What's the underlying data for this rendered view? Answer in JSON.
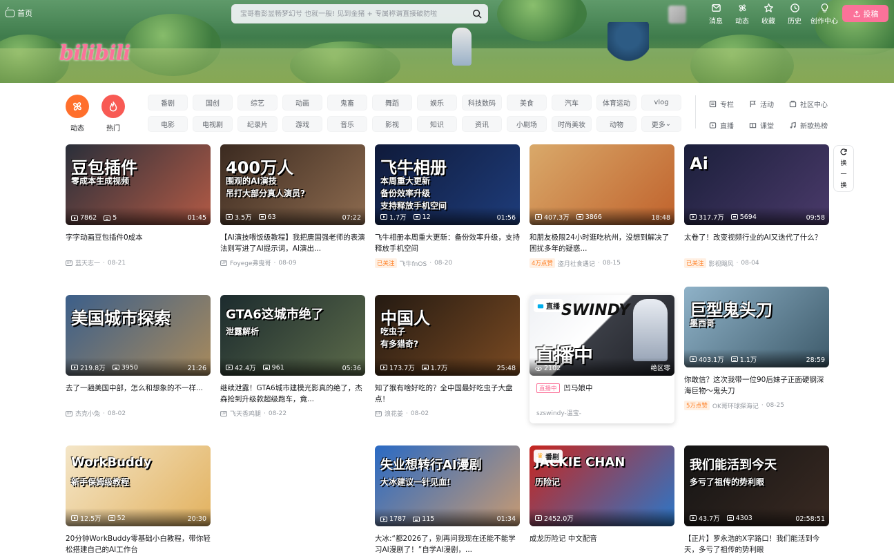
{
  "header": {
    "home_label": "首页",
    "search_placeholder": "宝哥看彭昱畅梦幻号 也就一般! 见到金猪 + 专属称谓直接破防啦",
    "logo_text": "bilibili",
    "nav": [
      {
        "label": "消息",
        "icon": "mail-icon"
      },
      {
        "label": "动态",
        "icon": "fan-icon"
      },
      {
        "label": "收藏",
        "icon": "star-icon"
      },
      {
        "label": "历史",
        "icon": "clock-icon"
      },
      {
        "label": "创作中心",
        "icon": "bulb-icon"
      }
    ],
    "upload_label": "投稿"
  },
  "channels": {
    "dynamic_label": "动态",
    "hot_label": "热门",
    "row1": [
      "番剧",
      "国创",
      "综艺",
      "动画",
      "鬼畜",
      "舞蹈",
      "娱乐",
      "科技数码",
      "美食",
      "汽车",
      "体育运动",
      "vlog"
    ],
    "row2": [
      "电影",
      "电视剧",
      "纪录片",
      "游戏",
      "音乐",
      "影视",
      "知识",
      "资讯",
      "小剧场",
      "时尚美妆",
      "动物",
      "更多"
    ],
    "side": [
      {
        "label": "专栏",
        "icon": "column-icon"
      },
      {
        "label": "活动",
        "icon": "flag-icon"
      },
      {
        "label": "社区中心",
        "icon": "community-icon"
      },
      {
        "label": "直播",
        "icon": "live-icon"
      },
      {
        "label": "课堂",
        "icon": "class-icon"
      },
      {
        "label": "新歌热榜",
        "icon": "music-icon"
      }
    ]
  },
  "refresh_label": [
    "换",
    "一",
    "换"
  ],
  "cards": [
    {
      "thumb_text": [
        "豆包插件",
        "零成本生成视频"
      ],
      "colors": [
        "#2a2f3a",
        "#b35a45"
      ],
      "views": "7862",
      "danmaku": "5",
      "duration": "01:45",
      "title": "字字动画豆包插件0成本",
      "follow": "",
      "author": "蓝天志一",
      "date": "08-21"
    },
    {
      "thumb_text": [
        "400万人",
        "围观的AI演技",
        "吊打大部分真人演员?"
      ],
      "colors": [
        "#3b2a20",
        "#8d6b4f"
      ],
      "views": "3.5万",
      "danmaku": "63",
      "duration": "07:22",
      "title": "【AI演技喂饭级教程】我把唐国强老师的表演法则写进了AI提示词，AI演出...",
      "follow": "",
      "author": "Foyege弗曳哥",
      "date": "08-09"
    },
    {
      "thumb_text": [
        "飞牛相册",
        "本周重大更新",
        "备份效率升级",
        "支持释放手机空间"
      ],
      "colors": [
        "#0f1a3a",
        "#1e3c7a"
      ],
      "views": "1.7万",
      "danmaku": "12",
      "duration": "01:56",
      "title": "飞牛相册本周重大更新：备份效率升级，支持释放手机空间",
      "follow": "已关注",
      "author": "飞牛fnOS",
      "date": "08-20"
    },
    {
      "thumb_text": [],
      "colors": [
        "#d9a96a",
        "#c0622c"
      ],
      "views": "407.3万",
      "danmaku": "3866",
      "duration": "18:48",
      "title": "和朋友极限24小时逛吃杭州，没想到解决了困扰多年的疑惑...",
      "follow": "4万点赞",
      "author": "盗月社食遇记",
      "date": "08-15"
    },
    {
      "thumb_text": [
        "Ai"
      ],
      "colors": [
        "#1b1f3b",
        "#4a3a6a"
      ],
      "views": "317.7万",
      "danmaku": "5694",
      "duration": "09:58",
      "title": "太卷了！改变视频行业的AI又迭代了什么？",
      "follow": "已关注",
      "author": "影视飓风",
      "date": "08-04"
    },
    {
      "thumb_text": [
        "美国城市探索"
      ],
      "colors": [
        "#3c5f8a",
        "#a88a5c"
      ],
      "views": "219.8万",
      "danmaku": "3950",
      "duration": "21:26",
      "title": "去了一趟美国中部，怎么和想象的不一样...",
      "follow": "",
      "author": "杰克小兔",
      "date": "08-02"
    },
    {
      "thumb_text": [
        "GTA6这城市绝了",
        "泄露解析"
      ],
      "colors": [
        "#1c2b2e",
        "#5c6b4a"
      ],
      "views": "42.4万",
      "danmaku": "961",
      "duration": "05:36",
      "title": "继续泄露！GTA6城市建模光影真的绝了，杰森抢到升级款超级跑车，竟...",
      "follow": "",
      "author": "飞天香鸡腿",
      "date": "08-22"
    },
    {
      "thumb_text": [
        "中国人",
        "吃虫子",
        "有多猎奇?"
      ],
      "colors": [
        "#241a12",
        "#7a4a22"
      ],
      "views": "173.7万",
      "danmaku": "1.7万",
      "duration": "25:48",
      "title": "知了猴有啥好吃的？全中国最好吃虫子大盘点！",
      "follow": "",
      "author": "浪花姜",
      "date": "08-02"
    },
    {
      "thumb_text": [
        "巨型鬼头刀",
        "墨西哥"
      ],
      "colors": [
        "#8fb2c8",
        "#3d5a6a"
      ],
      "views": "403.1万",
      "danmaku": "1.1万",
      "duration": "28:59",
      "title": "你敢信？这次我带一位90后妹子正面硬钢深海巨物～鬼头刀",
      "follow": "5万点赞",
      "author": "OK哥环球探海记",
      "date": "08-25"
    },
    {
      "thumb_text": [
        "WorkBuddy",
        "新手保姆级教程"
      ],
      "colors": [
        "#f4e6c8",
        "#e2b15e"
      ],
      "views": "12.5万",
      "danmaku": "52",
      "duration": "20:30",
      "title": "20分钟WorkBuddy零基础小白教程，带你轻松搭建自己的AI工作台",
      "follow": "",
      "author": "",
      "date": ""
    },
    {
      "thumb_text": [
        "失业想转行AI漫剧",
        "大冰建议一针见血!"
      ],
      "colors": [
        "#2a6ac4",
        "#c79a72"
      ],
      "views": "1787",
      "danmaku": "115",
      "duration": "01:34",
      "title": "大冰:“都2026了，别再问我现在还能不能学习AI漫剧了！”自学AI漫剧，...",
      "follow": "",
      "author": "",
      "date": ""
    },
    {
      "thumb_text": [
        "JACKIE CHAN",
        "历险记"
      ],
      "colors": [
        "#c7261f",
        "#2b77c9"
      ],
      "views": "2452.0万",
      "danmaku": "",
      "duration": "",
      "title": "成龙历险记 中文配音",
      "badge": "番剧",
      "follow": "",
      "author": "",
      "date": ""
    },
    {
      "thumb_text": [
        "我们能活到今天",
        "多亏了祖传的势利眼"
      ],
      "colors": [
        "#141414",
        "#3a2a22"
      ],
      "views": "43.7万",
      "danmaku": "4303",
      "duration": "02:58:51",
      "title": "【正片】罗永浩的X字路口！我们能活到今天，多亏了祖传的势利眼",
      "follow": "",
      "author": "",
      "date": ""
    }
  ],
  "live": {
    "badge": "直播",
    "thumb_text": [
      "SWINDY",
      "直播中"
    ],
    "viewers": "2102",
    "corner_label": "绝区零",
    "live_tag": "直播中",
    "title": "凹马娘中",
    "author": "szswindy-温宝-"
  }
}
